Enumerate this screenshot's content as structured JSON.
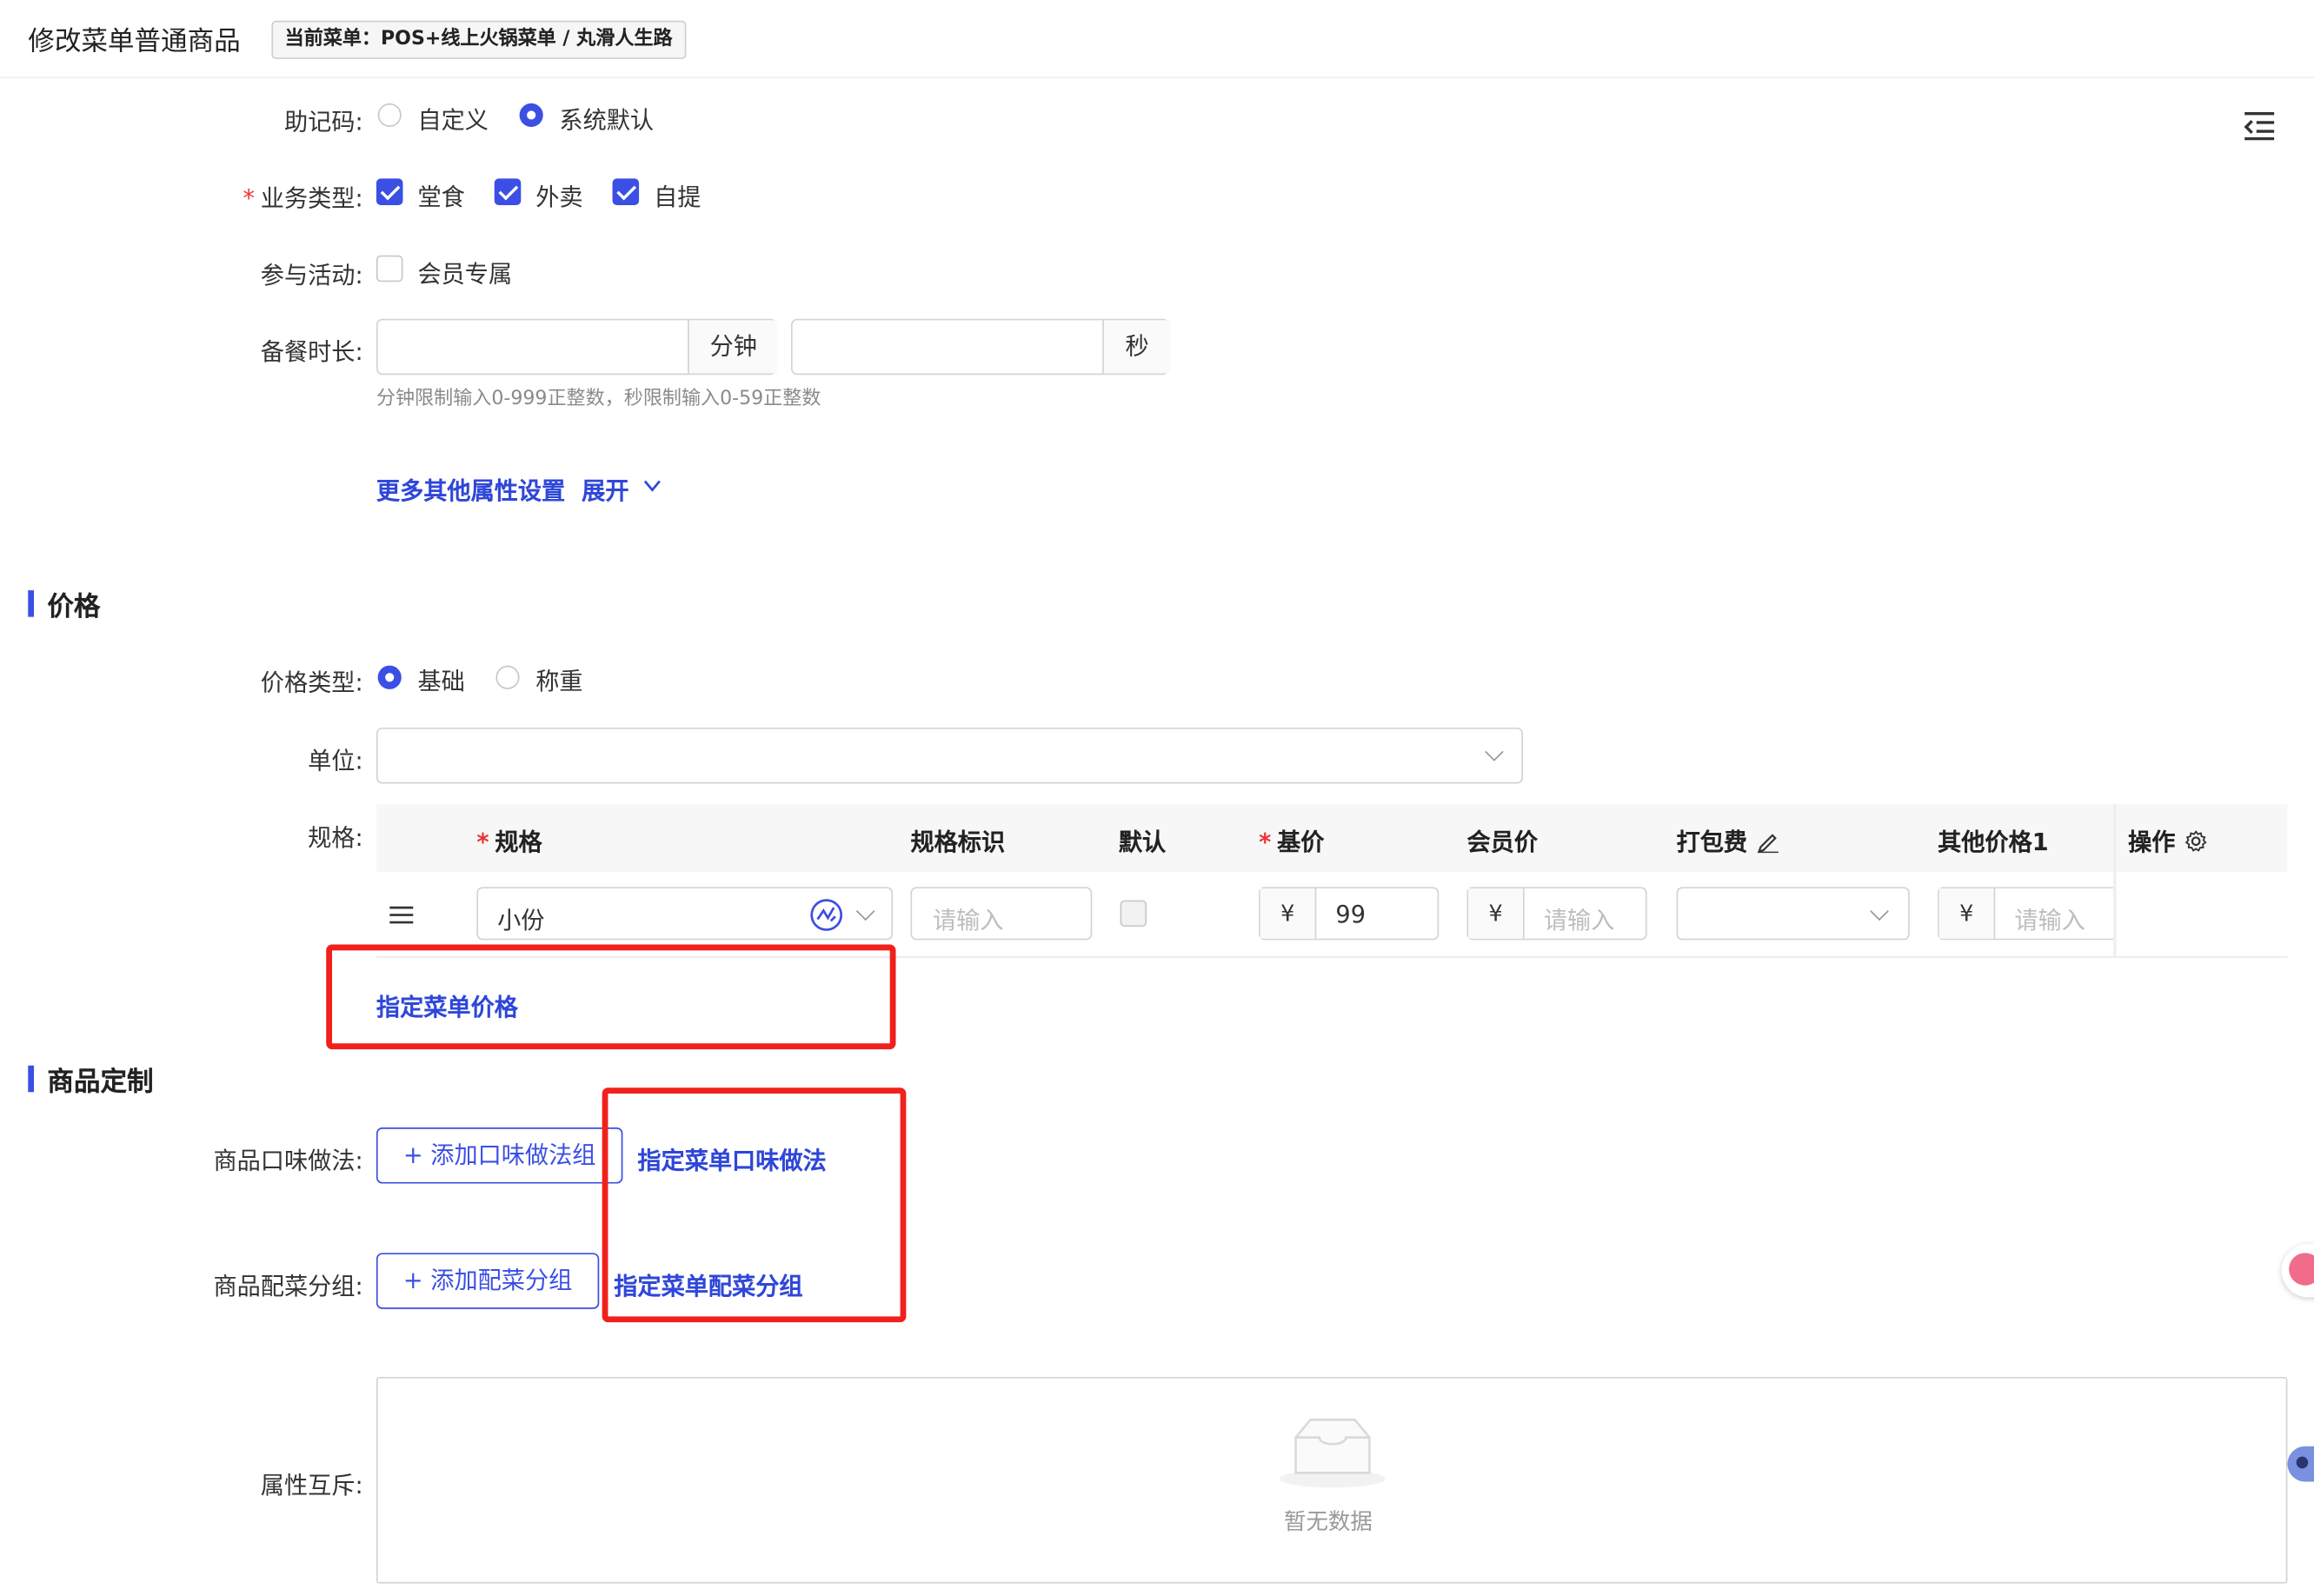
{
  "header": {
    "title": "修改菜单普通商品",
    "menu_badge": "当前菜单：POS+线上火锅菜单 / 丸滑人生路"
  },
  "mnemonic": {
    "label": "助记码:",
    "options": [
      "自定义",
      "系统默认"
    ],
    "selected": "系统默认"
  },
  "business_type": {
    "label": "业务类型:",
    "options": [
      {
        "label": "堂食",
        "checked": true
      },
      {
        "label": "外卖",
        "checked": true
      },
      {
        "label": "自提",
        "checked": true
      }
    ]
  },
  "activity": {
    "label": "参与活动:",
    "option": "会员专属",
    "checked": false
  },
  "prep_time": {
    "label": "备餐时长:",
    "minute_unit": "分钟",
    "second_unit": "秒",
    "minute_value": "",
    "second_value": "",
    "hint": "分钟限制输入0-999正整数，秒限制输入0-59正整数"
  },
  "more_settings": {
    "text": "更多其他属性设置",
    "expand": "展开"
  },
  "price_section": {
    "title": "价格",
    "price_type": {
      "label": "价格类型:",
      "options": [
        "基础",
        "称重"
      ],
      "selected": "基础"
    },
    "unit": {
      "label": "单位:",
      "value": ""
    },
    "spec": {
      "label": "规格:",
      "columns": [
        "规格",
        "规格标识",
        "默认",
        "基价",
        "会员价",
        "打包费",
        "其他价格1",
        "操作"
      ],
      "row": {
        "spec_name": "小份",
        "spec_id_placeholder": "请输入",
        "default_checked": false,
        "currency": "¥",
        "base_price": "99",
        "member_price_placeholder": "请输入",
        "packing_fee": "",
        "other_price_placeholder": "请输入"
      }
    },
    "assign_price_link": "指定菜单价格"
  },
  "custom_section": {
    "title": "商品定制",
    "flavor": {
      "label": "商品口味做法:",
      "add_button": "+ 添加口味做法组",
      "assign_link": "指定菜单口味做法"
    },
    "side_dish": {
      "label": "商品配菜分组:",
      "add_button": "+ 添加配菜分组",
      "assign_link": "指定菜单配菜分组"
    },
    "mutex": {
      "label": "属性互斥:",
      "empty_text": "暂无数据"
    }
  },
  "colors": {
    "accent": "#3b4fe4",
    "highlight": "#f0201c"
  }
}
